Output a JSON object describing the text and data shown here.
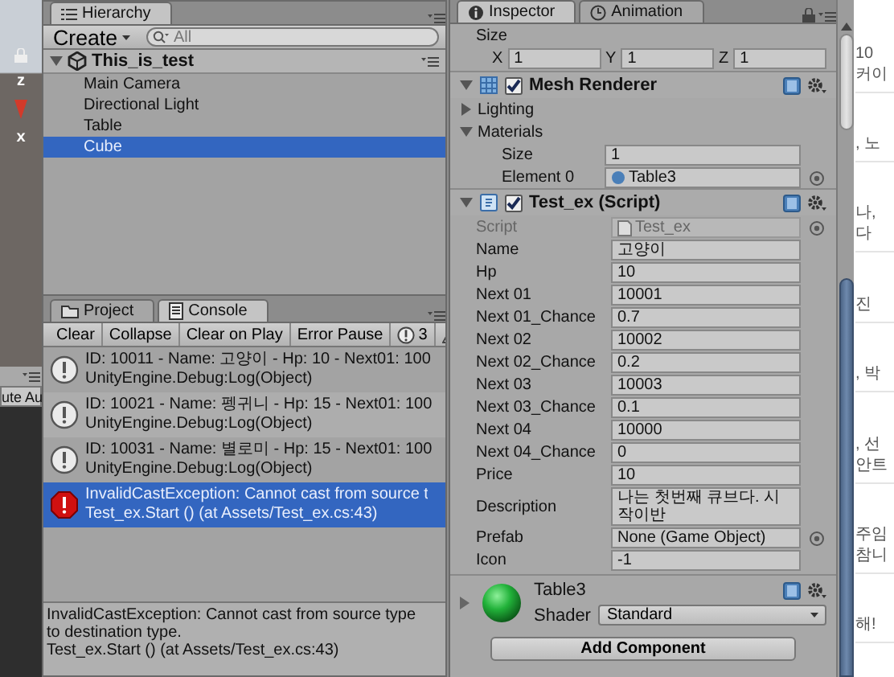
{
  "scene_view": {
    "axis_labels": [
      "z",
      "x"
    ],
    "button_text": "ute Au"
  },
  "hierarchy": {
    "tab": {
      "label": "Hierarchy",
      "selected": true
    },
    "create_button": "Create",
    "search": {
      "placeholder": "All"
    },
    "scene": {
      "name": "This_is_test",
      "expanded": true,
      "children": [
        {
          "name": "Main Camera",
          "selected": false
        },
        {
          "name": "Directional Light",
          "selected": false
        },
        {
          "name": "Table",
          "selected": false
        },
        {
          "name": "Cube",
          "selected": true
        }
      ]
    }
  },
  "console": {
    "tabs": [
      {
        "label": "Project",
        "kind": "project",
        "selected": false
      },
      {
        "label": "Console",
        "kind": "console",
        "selected": true
      }
    ],
    "toolbar": [
      "Clear",
      "Collapse",
      "Clear on Play",
      "Error Pause"
    ],
    "info_count": "3",
    "entries": [
      {
        "kind": "info",
        "message": "ID: 10011 - Name: 고양이 - Hp: 10 - Next01: 100",
        "trace": "UnityEngine.Debug:Log(Object)",
        "selected": false
      },
      {
        "kind": "info",
        "message": "ID: 10021 - Name: 펭귀니 - Hp: 15 - Next01: 100",
        "trace": "UnityEngine.Debug:Log(Object)",
        "selected": false
      },
      {
        "kind": "info",
        "message": "ID: 10031 - Name: 별로미 - Hp: 15 - Next01: 100",
        "trace": "UnityEngine.Debug:Log(Object)",
        "selected": false
      },
      {
        "kind": "error",
        "message": "InvalidCastException: Cannot cast from source t",
        "trace": "Test_ex.Start () (at Assets/Test_ex.cs:43)",
        "selected": true
      }
    ],
    "detail": [
      "InvalidCastException: Cannot cast from source type",
      "to destination type.",
      "Test_ex.Start () (at Assets/Test_ex.cs:43)"
    ]
  },
  "inspector": {
    "tabs": [
      {
        "label": "Inspector",
        "kind": "inspector",
        "selected": true
      },
      {
        "label": "Animation",
        "kind": "animation",
        "selected": false
      }
    ],
    "transform_size": {
      "label": "Size",
      "fields": [
        {
          "axis": "X",
          "value": "1"
        },
        {
          "axis": "Y",
          "value": "1"
        },
        {
          "axis": "Z",
          "value": "1"
        }
      ]
    },
    "mesh_renderer": {
      "title": "Mesh Renderer",
      "enabled": true,
      "expanded": true,
      "sections": [
        {
          "label": "Lighting",
          "expanded": false
        },
        {
          "label": "Materials",
          "expanded": true
        }
      ],
      "fields": [
        {
          "label": "Size",
          "value": "1",
          "kind": "text"
        },
        {
          "label": "Element 0",
          "value": "Table3",
          "kind": "material"
        }
      ]
    },
    "script": {
      "title": "Test_ex (Script)",
      "enabled": true,
      "expanded": true,
      "fields": [
        {
          "label": "Script",
          "value": "Test_ex",
          "kind": "script",
          "disabled": true
        },
        {
          "label": "Name",
          "value": "고양이",
          "kind": "text",
          "disabled": false
        },
        {
          "label": "Hp",
          "value": "10",
          "kind": "text",
          "disabled": false
        },
        {
          "label": "Next 01",
          "value": "10001",
          "kind": "text",
          "disabled": false
        },
        {
          "label": "Next 01_Chance",
          "value": "0.7",
          "kind": "text",
          "disabled": false
        },
        {
          "label": "Next 02",
          "value": "10002",
          "kind": "text",
          "disabled": false
        },
        {
          "label": "Next 02_Chance",
          "value": "0.2",
          "kind": "text",
          "disabled": false
        },
        {
          "label": "Next 03",
          "value": "10003",
          "kind": "text",
          "disabled": false
        },
        {
          "label": "Next 03_Chance",
          "value": "0.1",
          "kind": "text",
          "disabled": false
        },
        {
          "label": "Next 04",
          "value": "10000",
          "kind": "text",
          "disabled": false
        },
        {
          "label": "Next 04_Chance",
          "value": "0",
          "kind": "text",
          "disabled": false
        },
        {
          "label": "Price",
          "value": "10",
          "kind": "text",
          "disabled": false
        },
        {
          "label": "Description",
          "value": "나는 첫번째 큐브다. 시작이반",
          "kind": "text",
          "disabled": false
        },
        {
          "label": "Prefab",
          "value": "None (Game Object)",
          "kind": "object",
          "disabled": false
        },
        {
          "label": "Icon",
          "value": "-1",
          "kind": "text",
          "disabled": false
        }
      ]
    },
    "material": {
      "name": "Table3",
      "shader_label": "Shader",
      "shader": "Standard",
      "expanded": false
    },
    "add_component": "Add Component"
  },
  "web_page": {
    "fragments": [
      [
        "10",
        "커이"
      ],
      [
        ", 노"
      ],
      [
        "나,",
        "다"
      ],
      [
        "진"
      ],
      [
        ", 박"
      ],
      [
        ", 선",
        "안트"
      ],
      [
        "주임",
        "참니"
      ],
      [
        "해!"
      ]
    ]
  }
}
